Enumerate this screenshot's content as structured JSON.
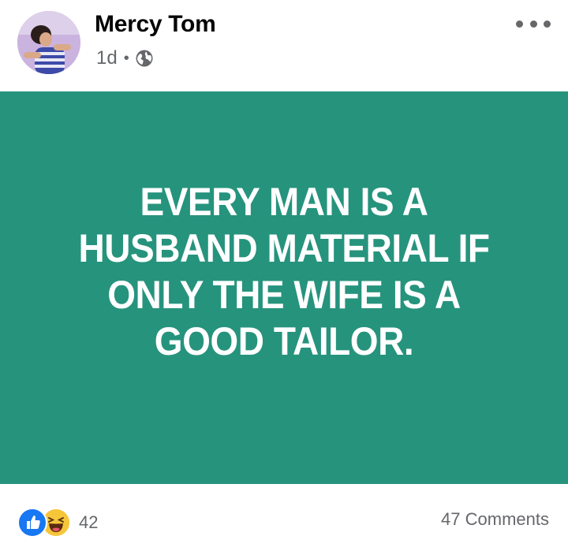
{
  "post": {
    "author": "Mercy Tom",
    "time": "1d",
    "separator": "•",
    "privacy_icon": "globe-icon",
    "more_icon": "more-options-icon"
  },
  "content": {
    "text": "EVERY MAN IS A HUSBAND MATERIAL IF ONLY THE WIFE IS A GOOD TAILOR.",
    "background_color": "#26937d",
    "text_color": "#ffffff"
  },
  "footer": {
    "reaction_icons": [
      "like-icon",
      "haha-icon"
    ],
    "reaction_count": "42",
    "comments": "47 Comments"
  },
  "colors": {
    "meta_gray": "#65676b",
    "like_blue": "#1877f2",
    "haha_yellow": "#f7c53a"
  }
}
